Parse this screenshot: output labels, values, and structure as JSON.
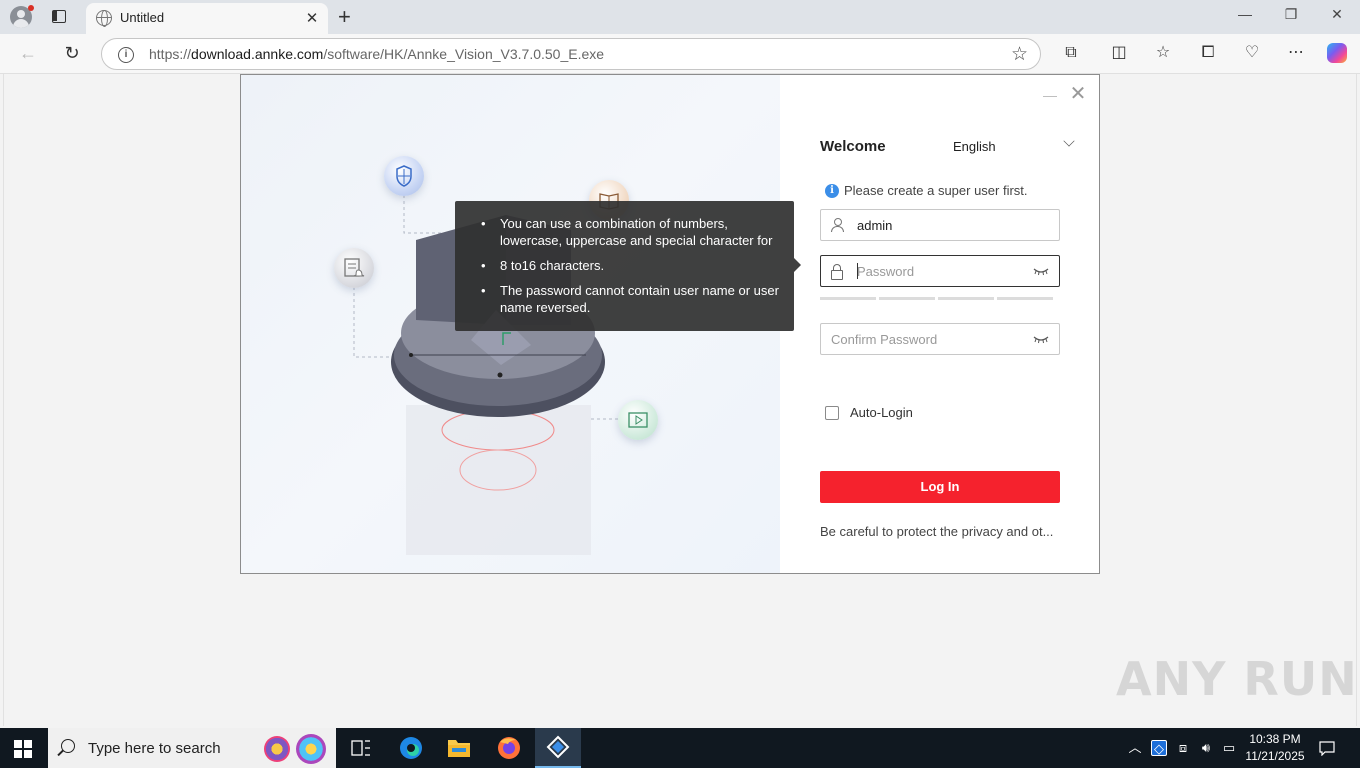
{
  "browser": {
    "tab_title": "Untitled",
    "url_prefix": "https://",
    "url_host": "download.annke.com",
    "url_path": "/software/HK/Annke_Vision_V3.7.0.50_E.exe"
  },
  "app": {
    "welcome": "Welcome",
    "language": "English",
    "notice": "Please create a super user first.",
    "username_value": "admin",
    "password_placeholder": "Password",
    "confirm_placeholder": "Confirm Password",
    "auto_login_label": "Auto-Login",
    "login_button": "Log In",
    "privacy_text": "Be careful to protect the privacy and ot...",
    "colors": {
      "primary": "#f5222d",
      "info": "#3b8ee8"
    }
  },
  "tooltip": {
    "items": [
      "You can use a combination of numbers, lowercase, uppercase and special character for",
      "8 to16 characters.",
      "The password cannot contain user name or user name reversed."
    ]
  },
  "watermark": "ANY RUN",
  "taskbar": {
    "search_placeholder": "Type here to search",
    "time": "10:38 PM",
    "date": "11/21/2025"
  }
}
